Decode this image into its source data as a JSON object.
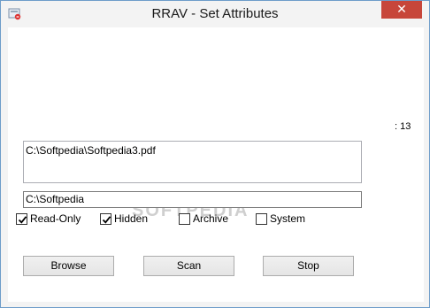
{
  "window": {
    "title": "RRAV - Set Attributes",
    "close_label": "✕"
  },
  "counter": ": 13",
  "path_list": {
    "items": [
      "C:\\Softpedia\\Softpedia3.pdf"
    ]
  },
  "folder_input": {
    "value": "C:\\Softpedia"
  },
  "attributes": [
    {
      "label": "Read-Only",
      "checked": true
    },
    {
      "label": "Hidden",
      "checked": true
    },
    {
      "label": "Archive",
      "checked": false
    },
    {
      "label": "System",
      "checked": false
    }
  ],
  "buttons": {
    "browse": "Browse",
    "scan": "Scan",
    "stop": "Stop"
  },
  "watermark": "SOFTPEDIA"
}
